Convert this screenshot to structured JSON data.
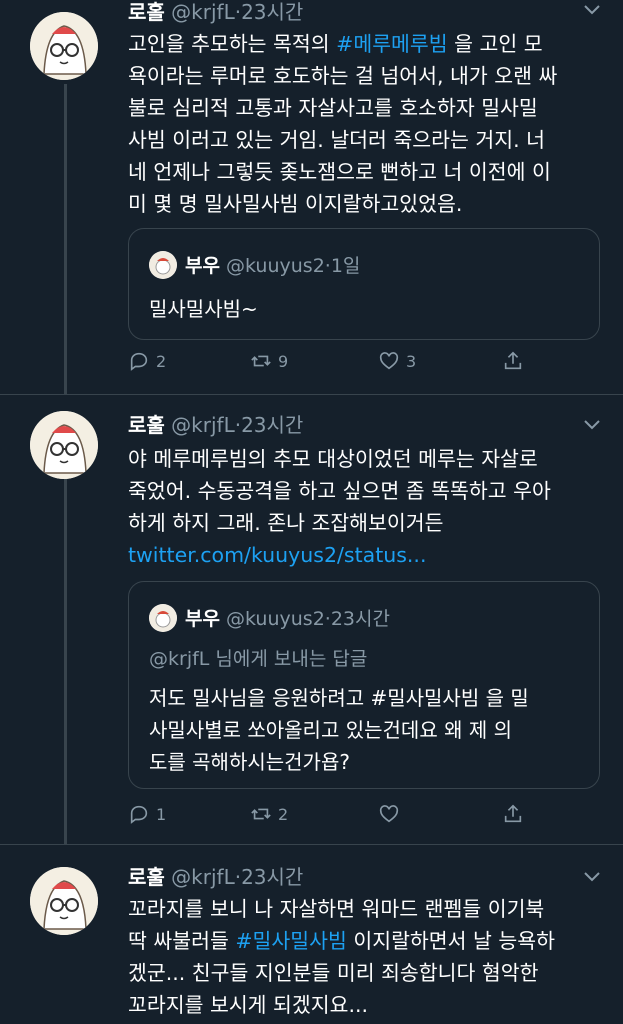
{
  "tweets": [
    {
      "name": "로홀",
      "handle": "@krjfL",
      "dot": "·",
      "time": "23시간",
      "text_pre": "고인을 추모하는 목적의 ",
      "hashtag": "#메루메루빔",
      "text_post": " 을 고인 모\n욕이라는 루머로 호도하는 걸 넘어서, 내가 오랜 싸\n불로 심리적 고통과 자살사고를 호소하자 밀사밀\n사빔 이러고 있는 거임. 날더러 죽으라는 거지. 너\n네 언제나 그렇듯 좆노잼으로 뻔하고 너 이전에 이\n미 몇 명 밀사밀사빔 이지랄하고있었음.",
      "quote": {
        "name": "부우",
        "handle": "@kuuyus2",
        "time": "1일",
        "text": "밀사밀사빔~"
      },
      "actions": {
        "reply": "2",
        "retweet": "9",
        "like": "3"
      }
    },
    {
      "name": "로훌",
      "handle": "@krjfL",
      "dot": "·",
      "time": "23시간",
      "text": "야 메루메루빔의 추모 대상이었던 메루는 자살로\n죽었어. 수동공격을 하고 싶으면 좀 똑똑하고 우아\n하게 하지 그래. 존나 조잡해보이거든",
      "link": "twitter.com/kuuyus2/status...",
      "quote": {
        "name": "부우",
        "handle": "@kuuyus2",
        "time": "23시간",
        "reply_to": "@krjfL 님에게 보내는 답글",
        "text": "저도 밀사님을 응원하려고 #밀사밀사빔 을 밀\n사밀사별로 쏘아올리고 있는건데요 왜 제 의\n도를 곡해하시는건가욥?"
      },
      "actions": {
        "reply": "1",
        "retweet": "2",
        "like": ""
      }
    },
    {
      "name": "로훌",
      "handle": "@krjfL",
      "dot": "·",
      "time": "23시간",
      "text_pre": "꼬라지를 보니 나 자살하면 워마드 랜펨들 이기북\n딱 싸불러들 ",
      "hashtag": "#밀사밀사빔",
      "text_post": " 이지랄하면서 날 능욕하\n겠군... 친구들 지인분들 미리 죄송합니다 혐악한\n꼬라지를 보시게 되겠지요..."
    }
  ],
  "icons": {
    "reply": "reply-icon",
    "retweet": "retweet-icon",
    "like": "heart-icon",
    "share": "share-icon",
    "more": "chevron-down-icon"
  },
  "colors": {
    "background": "#15202b",
    "text": "#ffffff",
    "secondary": "#8899a6",
    "accent": "#1da1f2",
    "border": "#38444d"
  }
}
